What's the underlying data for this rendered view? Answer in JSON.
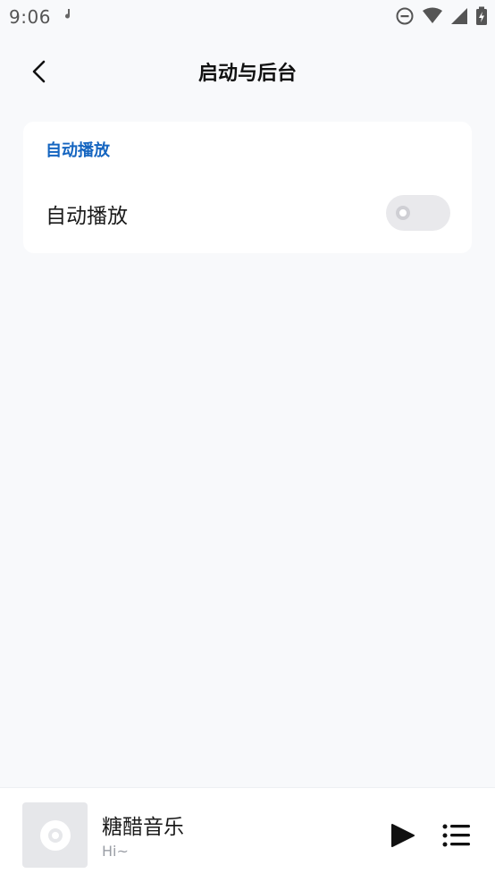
{
  "status_bar": {
    "time": "9:06",
    "icons": [
      "music-note-icon",
      "do-not-disturb-icon",
      "wifi-icon",
      "cellular-signal-icon",
      "battery-charging-icon"
    ]
  },
  "header": {
    "title": "启动与后台",
    "back_icon": "chevron-left-icon"
  },
  "settings": {
    "section_title": "自动播放",
    "items": [
      {
        "label": "自动播放",
        "enabled": false
      }
    ]
  },
  "player": {
    "title": "糖醋音乐",
    "subtitle": "Hi~",
    "play_icon": "play-icon",
    "playlist_icon": "playlist-icon"
  },
  "colors": {
    "background": "#f8f9fb",
    "card": "#ffffff",
    "accent": "#1565c0",
    "toggle_off": "#e9e9ec",
    "text_primary": "#1a1a1a",
    "text_secondary": "#9a9ea5"
  }
}
